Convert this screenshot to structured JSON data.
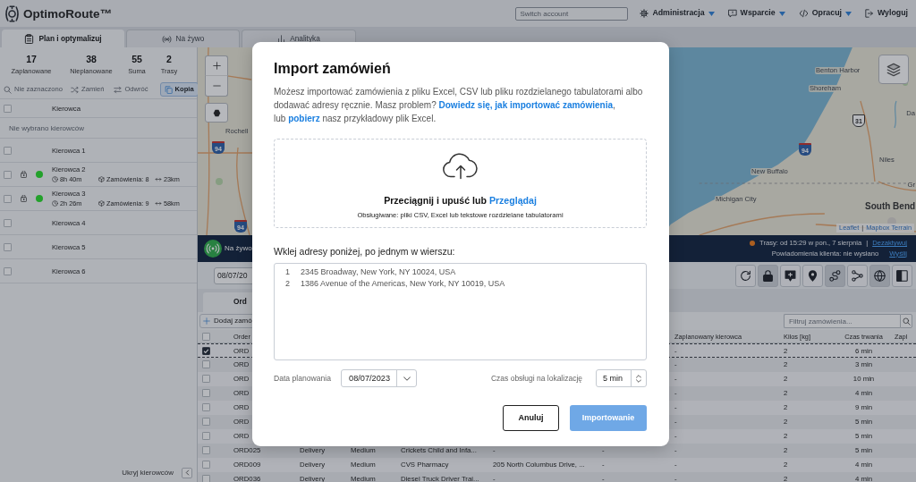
{
  "header": {
    "logo": "OptimoRoute™",
    "account_search": {
      "placeholder": "Switch account"
    },
    "menu": [
      {
        "label": "Administracja",
        "dropdown": true
      },
      {
        "label": "Wsparcie",
        "dropdown": true
      },
      {
        "label": "Opracuj",
        "dropdown": true
      },
      {
        "label": "Wyloguj",
        "dropdown": false
      }
    ]
  },
  "tabs": [
    {
      "label": "Plan i optymalizuj",
      "selected": true
    },
    {
      "label": "Na żywo",
      "selected": false
    },
    {
      "label": "Analityka",
      "selected": false
    }
  ],
  "summary": [
    {
      "value": "17",
      "label": "Zaplanowane"
    },
    {
      "value": "38",
      "label": "Nieplanowane"
    },
    {
      "value": "55",
      "label": "Suma"
    },
    {
      "value": "2",
      "label": "Trasy"
    }
  ],
  "driver_tools": [
    {
      "label": "Nie zaznaczono",
      "disabled": true
    },
    {
      "label": "Zamień",
      "disabled": true
    },
    {
      "label": "Odwróć",
      "disabled": true
    },
    {
      "label": "Kopia",
      "disabled": false
    }
  ],
  "drivers": {
    "header": "Kierowca",
    "header_checked": false,
    "empty_message": "Nie wybrano kierowców",
    "rows": [
      {
        "name": "Kierowca 1",
        "checked": false,
        "locked": false
      },
      {
        "name": "Kierowca 2",
        "checked": false,
        "locked": true,
        "color": "#23a12b",
        "duration": "8h 40m",
        "orders": "Zamówienia: 8",
        "distance": "23km"
      },
      {
        "name": "Kierowca 3",
        "checked": false,
        "locked": true,
        "color": "#23a12b",
        "duration": "2h 26m",
        "orders": "Zamówienia: 9",
        "distance": "58km"
      },
      {
        "name": "Kierowca 4",
        "checked": false,
        "locked": false
      },
      {
        "name": "Kierowca 5",
        "checked": false,
        "locked": false
      },
      {
        "name": "Kierowca 6",
        "checked": false,
        "locked": false
      }
    ],
    "hide_label": "Ukryj kierowców"
  },
  "map": {
    "labels": [
      "Benton Harbor",
      "Shoreham",
      "Da",
      "Rochell",
      "Niles",
      "New Buffalo",
      "Gr",
      "Michigan City",
      "South Bend"
    ],
    "shields": [
      {
        "text": "31",
        "kind": "us_route"
      },
      {
        "text": "94",
        "kind": "interstate"
      },
      {
        "text": "94",
        "kind": "interstate"
      },
      {
        "text": "94",
        "kind": "interstate"
      }
    ],
    "attribution": {
      "links": [
        "Leaflet",
        "Mapbox Terrain"
      ],
      "separator": "|"
    }
  },
  "live_bar": {
    "button": "Na żywo",
    "routes": "Trasy: od 15:29 w pon., 7 sierpnia",
    "separator": "|",
    "deactivate": "Dezaktywuj",
    "notifications": "Powiadomienia klienta: nie wysłano",
    "send": "Wyślij"
  },
  "toolbar": {
    "date": "08/07/20",
    "tools": [
      {
        "active": false
      },
      {
        "active": true
      },
      {
        "active": false
      },
      {
        "active": false
      },
      {
        "active": true
      },
      {
        "active": false
      },
      {
        "active": true
      },
      {
        "active": false
      }
    ]
  },
  "orders": {
    "tabs": [
      {
        "label": "Ord",
        "selected": true
      }
    ],
    "add_button": "Dodaj zamó",
    "filter": {
      "placeholder": "Filtruj zamówienia..."
    },
    "columns": {
      "header_checked": false,
      "order": "Order",
      "driver": "Zaplanowany kierowca",
      "kilos": "Kilos [kg]",
      "duration": "Czas trwania",
      "column_11": "Zapl"
    },
    "rows": [
      {
        "checked": true,
        "selected": true,
        "order": "ORD",
        "driver": "-",
        "kilos": "2",
        "duration": "6 min"
      },
      {
        "checked": false,
        "selected": false,
        "order": "ORD",
        "driver": "-",
        "kilos": "2",
        "duration": "3 min"
      },
      {
        "checked": false,
        "selected": false,
        "order": "ORD",
        "driver": "-",
        "kilos": "2",
        "duration": "10 min"
      },
      {
        "checked": false,
        "selected": false,
        "order": "ORD",
        "driver": "-",
        "kilos": "2",
        "duration": "4 min"
      },
      {
        "checked": false,
        "selected": false,
        "order": "ORD",
        "driver": "-",
        "kilos": "2",
        "duration": "9 min"
      },
      {
        "checked": false,
        "selected": false,
        "order": "ORD",
        "driver": "-",
        "kilos": "2",
        "duration": "5 min"
      },
      {
        "checked": false,
        "selected": false,
        "order": "ORD",
        "driver": "-",
        "kilos": "2",
        "duration": "5 min"
      },
      {
        "checked": false,
        "selected": false,
        "order": "ORD025",
        "column_3": "Delivery",
        "column_4": "Medium",
        "column_5": "Crickets Child and Infa...",
        "column_6": "-",
        "column_7": "-",
        "driver": "-",
        "kilos": "2",
        "duration": "5 min"
      },
      {
        "checked": false,
        "selected": false,
        "order": "ORD009",
        "column_3": "Delivery",
        "column_4": "Medium",
        "column_5": "CVS Pharmacy",
        "column_6": "205 North Columbus Drive, ...",
        "column_7": "-",
        "driver": "-",
        "kilos": "2",
        "duration": "4 min"
      },
      {
        "checked": false,
        "selected": false,
        "order": "ORD036",
        "column_3": "Delivery",
        "column_4": "Medium",
        "column_5": "Diesel Truck Driver Trai...",
        "column_6": "-",
        "column_7": "-",
        "driver": "-",
        "kilos": "2",
        "duration": "4 min"
      }
    ]
  },
  "import_dialog": {
    "title": "Import zamówień",
    "description": [
      [
        {
          "kind": "text",
          "text": "Możesz importować zamówienia z pliku Excel, CSV lub pliku rozdzielanego tabulatorami albo dodawać adresy ręcznie. Masz problem? "
        },
        {
          "kind": "link",
          "text": "Dowiedz się, jak importować zamówienia"
        },
        {
          "kind": "text",
          "text": ","
        }
      ],
      [
        {
          "kind": "text",
          "text": "lub "
        },
        {
          "kind": "link",
          "text": "pobierz"
        },
        {
          "kind": "text",
          "text": " nasz przykładowy plik Excel."
        }
      ]
    ],
    "dropzone": {
      "prompt": "Przeciągnij i upuść lub",
      "browse": "Przeglądaj",
      "formats": "Obsługiwane: pliki CSV, Excel lub tekstowe rozdzielane tabulatorami"
    },
    "paste_label": "Wklej adresy poniżej, po jednym w wierszu:",
    "addresses": [
      {
        "number": "1",
        "text": "2345 Broadway, New York, NY 10024, USA"
      },
      {
        "number": "2",
        "text": "1386 Avenue of the Americas, New York, NY 10019, USA"
      }
    ],
    "date_label": "Data planowania",
    "date": "08/07/2023",
    "service_label": "Czas obsługi na lokalizację",
    "service_time": "5 min",
    "buttons": [
      {
        "label": "Anuluj",
        "kind": "secondary",
        "disabled": false
      },
      {
        "label": "Importowanie",
        "kind": "primary",
        "disabled": true
      }
    ]
  }
}
